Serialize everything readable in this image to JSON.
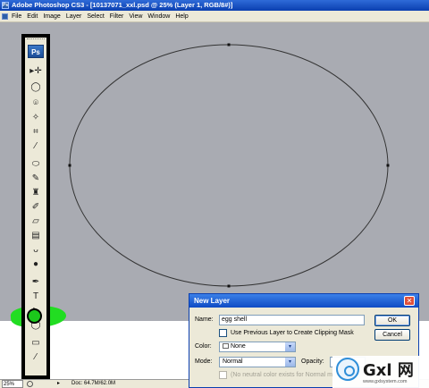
{
  "window": {
    "app_icon": "Ps",
    "title": "Adobe Photoshop CS3 - [10137071_xxl.psd @ 25% (Layer 1, RGB/8#)]"
  },
  "menubar": {
    "items": [
      "File",
      "Edit",
      "Image",
      "Layer",
      "Select",
      "Filter",
      "View",
      "Window",
      "Help"
    ]
  },
  "toolbox": {
    "logo": "Ps",
    "tools": [
      {
        "name": "move-tool-icon",
        "glyph": "▸✛"
      },
      {
        "name": "lasso-tool-icon",
        "glyph": "◯"
      },
      {
        "name": "quick-selection-tool-icon",
        "glyph": "⌾"
      },
      {
        "name": "magic-wand-tool-icon",
        "glyph": "✧"
      },
      {
        "name": "crop-tool-icon",
        "glyph": "⌗"
      },
      {
        "name": "eyedropper-tool-icon",
        "glyph": "⁄"
      },
      {
        "name": "spot-healing-tool-icon",
        "glyph": "⬭"
      },
      {
        "name": "brush-tool-icon",
        "glyph": "✎"
      },
      {
        "name": "clone-stamp-tool-icon",
        "glyph": "♜"
      },
      {
        "name": "history-brush-tool-icon",
        "glyph": "✐"
      },
      {
        "name": "eraser-tool-icon",
        "glyph": "▱"
      },
      {
        "name": "gradient-tool-icon",
        "glyph": "▤"
      },
      {
        "name": "blur-tool-icon",
        "glyph": "ᴗ"
      },
      {
        "name": "dodge-tool-icon",
        "glyph": "●"
      },
      {
        "name": "pen-tool-icon",
        "glyph": "✒"
      },
      {
        "name": "type-tool-icon",
        "glyph": "T"
      },
      {
        "name": "path-selection-tool-icon",
        "glyph": "➤"
      },
      {
        "name": "ellipse-tool-icon",
        "glyph": "◯"
      },
      {
        "name": "notes-tool-icon",
        "glyph": "▭"
      },
      {
        "name": "eyedropper-tool-2-icon",
        "glyph": "⁄"
      }
    ]
  },
  "statusbar": {
    "zoom": "25%",
    "nav_arrow": "▸",
    "doc_info": "Doc: 64.7M/62.0M"
  },
  "dialog": {
    "title": "New Layer",
    "close_glyph": "✕",
    "name_label": "Name:",
    "name_value": "egg shell",
    "checkbox_label": "Use Previous Layer to Create Clipping Mask",
    "color_label": "Color:",
    "color_value": "None",
    "mode_label": "Mode:",
    "mode_value": "Normal",
    "opacity_label": "Opacity:",
    "neutral_text": "(No neutral color exists for Normal m",
    "ok_label": "OK",
    "cancel_label": "Cancel",
    "dropdown_glyph": "▾"
  },
  "watermark": {
    "text": "Gxl 网",
    "sub": "www.gxlsystem.com"
  }
}
